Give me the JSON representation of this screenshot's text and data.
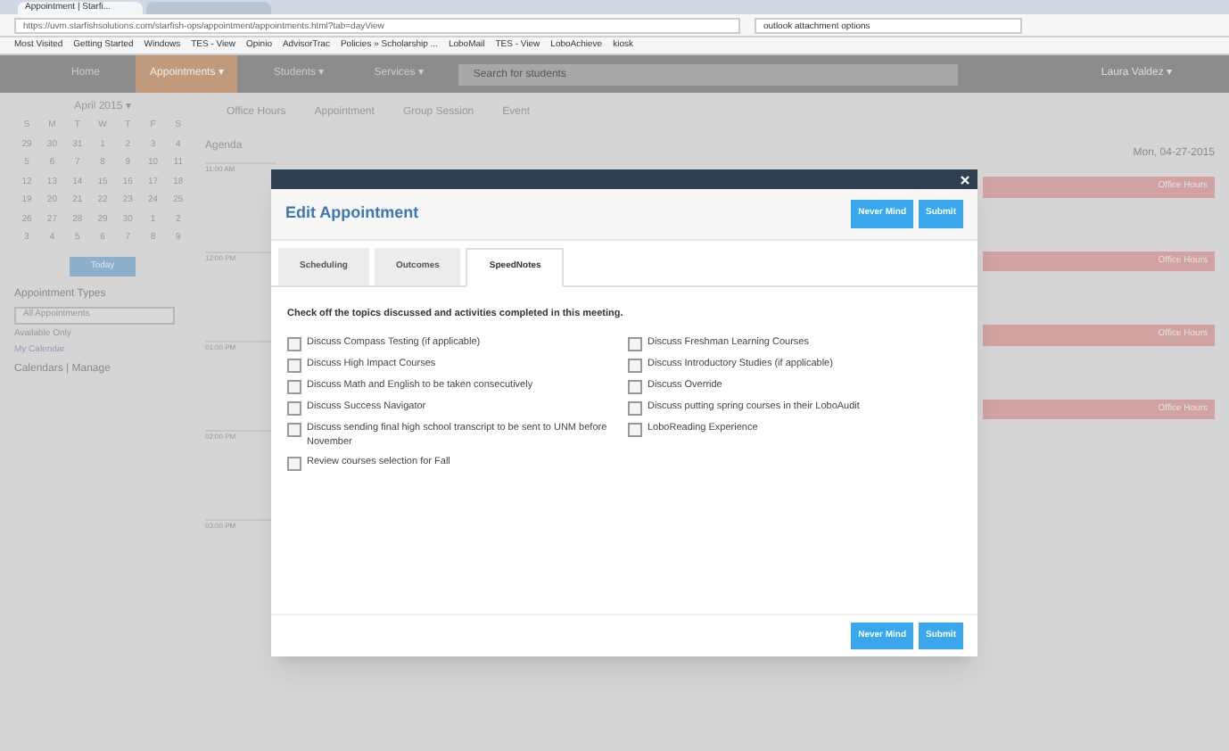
{
  "browser": {
    "tabs": [
      {
        "label": "Appointment | Starfi...",
        "selected": true
      },
      {
        "selected": false
      }
    ],
    "url": "https://uvm.starfishsolutions.com/starfish-ops/appointment/appointments.html?tab=dayView",
    "search": "outlook attachment options",
    "bookmarks": [
      "Most Visited",
      "Getting Started",
      "Windows",
      "TES - View",
      "Opinio",
      "AdvisorTrac",
      "Policies » Scholarship ...",
      "LoboMail",
      "TES - View",
      "LoboAchieve",
      "kiosk"
    ]
  },
  "nav": {
    "items": [
      {
        "label": "Home",
        "selected": false
      },
      {
        "label": "Appointments ▾",
        "selected": true
      },
      {
        "label": "Students ▾",
        "selected": false
      },
      {
        "label": "Services ▾",
        "selected": false
      }
    ],
    "search_placeholder": "Search for students",
    "user": "Laura Valdez ▾"
  },
  "sidebar": {
    "month": "April 2015 ▾",
    "weekdays": [
      "S",
      "M",
      "T",
      "W",
      "T",
      "F",
      "S"
    ],
    "weeks": [
      [
        "29",
        "30",
        "31",
        "1",
        "2",
        "3",
        "4"
      ],
      [
        "5",
        "6",
        "7",
        "8",
        "9",
        "10",
        "11"
      ],
      [
        "12",
        "13",
        "14",
        "15",
        "16",
        "17",
        "18"
      ],
      [
        "19",
        "20",
        "21",
        "22",
        "23",
        "24",
        "25"
      ],
      [
        "26",
        "27",
        "28",
        "29",
        "30",
        "1",
        "2"
      ],
      [
        "3",
        "4",
        "5",
        "6",
        "7",
        "8",
        "9"
      ]
    ],
    "today_button": "Today",
    "types_title": "Appointment Types",
    "types_value": "All Appointments",
    "available_only": "Available Only",
    "my_calendar": "My Calendar",
    "calendars_title": "Calendars | Manage"
  },
  "toolbar": [
    "Office Hours",
    "Appointment",
    "Group Session",
    "Event"
  ],
  "day": {
    "agenda": "Agenda",
    "date": "Mon, 04-27-2015",
    "times": [
      "11:00 AM",
      "12:00 PM",
      "01:00 PM",
      "02:00 PM",
      "03:00 PM"
    ],
    "events": [
      "Office Hours",
      "Office Hours",
      "Office Hours",
      "Office Hours"
    ]
  },
  "modal": {
    "title": "Edit Appointment",
    "buttons": [
      "Never Mind",
      "Submit"
    ],
    "tabs": [
      {
        "label": "Scheduling",
        "selected": false
      },
      {
        "label": "Outcomes",
        "selected": false
      },
      {
        "label": "SpeedNotes",
        "selected": true
      }
    ],
    "instruction": "Check off the topics discussed and activities completed in this meeting.",
    "columns": [
      [
        {
          "label": "Discuss Compass Testing (if applicable)",
          "checked": false
        },
        {
          "label": "Discuss High Impact Courses",
          "checked": false
        },
        {
          "label": "Discuss Math and English to be taken consecutively",
          "checked": false
        },
        {
          "label": "Discuss Success Navigator",
          "checked": false
        },
        {
          "label": "Discuss sending final high school transcript to be sent to UNM before November",
          "checked": false
        },
        {
          "label": "Review courses selection for Fall",
          "checked": false
        }
      ],
      [
        {
          "label": "Discuss Freshman Learning Courses",
          "checked": false
        },
        {
          "label": "Discuss Introductory Studies (if applicable)",
          "checked": false
        },
        {
          "label": "Discuss Override",
          "checked": false
        },
        {
          "label": "Discuss putting spring courses in their LoboAudit",
          "checked": false
        },
        {
          "label": "LoboReading Experience",
          "checked": false
        }
      ]
    ],
    "footer_buttons": [
      "Never Mind",
      "Submit"
    ]
  }
}
